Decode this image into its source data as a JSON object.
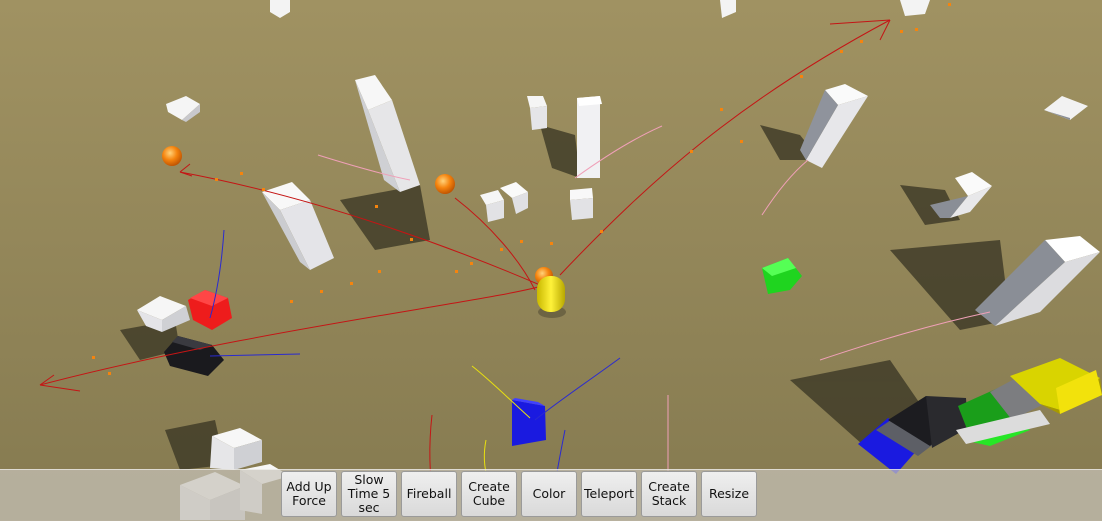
{
  "scene": {
    "ground_color": "#8f8257",
    "player_color": "#f2e20c",
    "fireball_color": "#f5840e",
    "trail_color": "#c41515",
    "objects": [
      {
        "name": "white-cube",
        "color": "#f4f4f4"
      },
      {
        "name": "red-cube",
        "color": "#ee1c1c"
      },
      {
        "name": "black-cube",
        "color": "#1a1a1e"
      },
      {
        "name": "blue-cube",
        "color": "#1a1ae0"
      },
      {
        "name": "green-cube",
        "color": "#1fd41f"
      },
      {
        "name": "stacked-cubes",
        "colors": [
          "#1a1ae0",
          "#222226",
          "#1a9e1a",
          "#7c7d80",
          "#f2e20c"
        ]
      }
    ]
  },
  "toolbar": {
    "buttons": [
      {
        "label": "Add Up\nForce"
      },
      {
        "label": "Slow\nTime 5\nsec"
      },
      {
        "label": "Fireball"
      },
      {
        "label": "Create\nCube"
      },
      {
        "label": "Color"
      },
      {
        "label": "Teleport"
      },
      {
        "label": "Create\nStack"
      },
      {
        "label": "Resize"
      }
    ]
  }
}
